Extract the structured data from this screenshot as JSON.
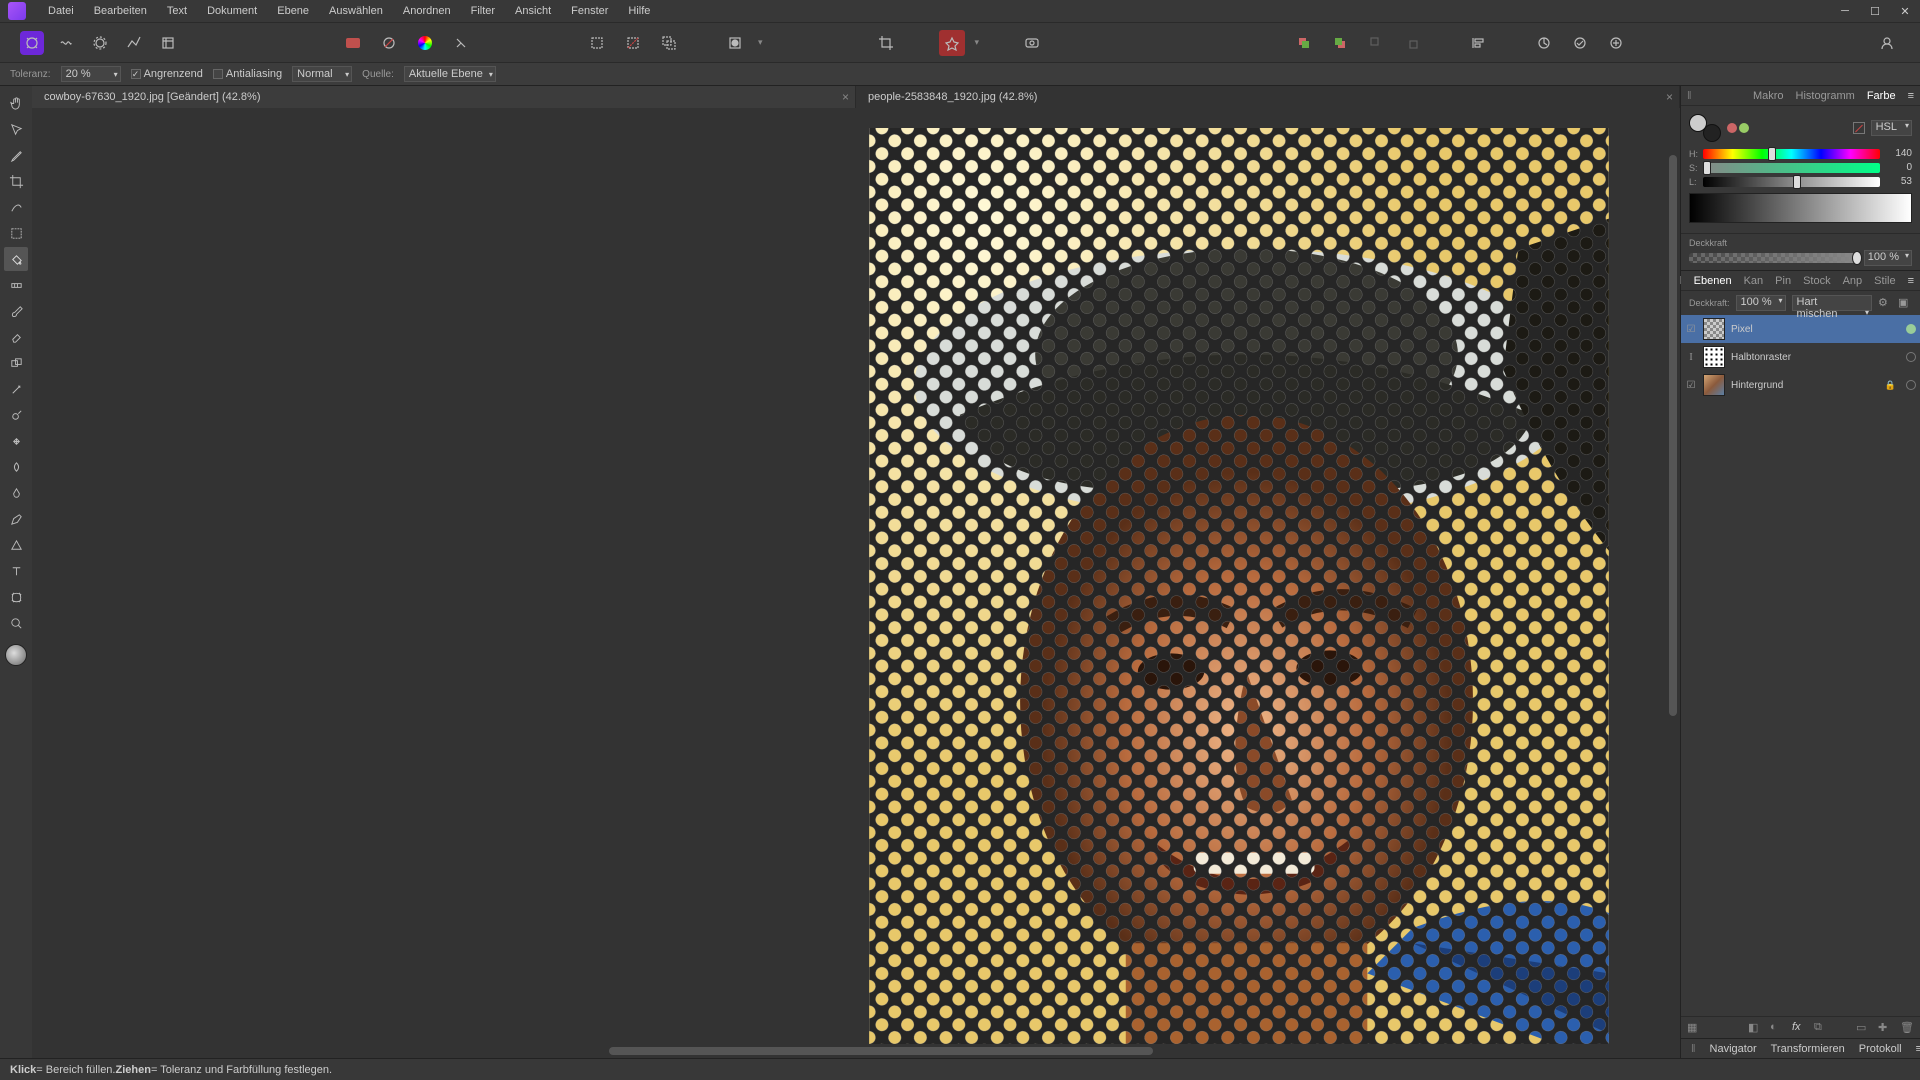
{
  "menu": [
    "Datei",
    "Bearbeiten",
    "Text",
    "Dokument",
    "Ebene",
    "Auswählen",
    "Anordnen",
    "Filter",
    "Ansicht",
    "Fenster",
    "Hilfe"
  ],
  "context": {
    "tolerance_label": "Toleranz:",
    "tolerance_value": "20 %",
    "contiguous": "Angrenzend",
    "antialias": "Antialiasing",
    "blendmode": "Normal",
    "source_label": "Quelle:",
    "source_value": "Aktuelle Ebene"
  },
  "doc_tabs": [
    {
      "title": "cowboy-67630_1920.jpg [Geändert] (42.8%)",
      "active": true
    },
    {
      "title": "people-2583848_1920.jpg (42.8%)",
      "active": false
    }
  ],
  "color_panel": {
    "tabs": [
      "Makro",
      "Histogramm",
      "Farbe"
    ],
    "active_tab": "Farbe",
    "mode": "HSL",
    "h": {
      "label": "H:",
      "value": "140",
      "pos": 39
    },
    "s": {
      "label": "S:",
      "value": "0",
      "pos": 2
    },
    "l": {
      "label": "L:",
      "value": "53",
      "pos": 53
    },
    "opacity_label": "Deckkraft",
    "opacity_value": "100 %"
  },
  "layer_panel": {
    "tabs": [
      "Ebenen",
      "Kan",
      "Pin",
      "Stock",
      "Anp",
      "Stile"
    ],
    "active_tab": "Ebenen",
    "opacity_label": "Deckkraft:",
    "opacity_value": "100 %",
    "blendmode": "Hart mischen",
    "layers": [
      {
        "name": "Pixel",
        "selected": true,
        "thumb": "checker",
        "lock": false
      },
      {
        "name": "Halbtonraster",
        "selected": false,
        "thumb": "halftone",
        "lock": false,
        "editing": true
      },
      {
        "name": "Hintergrund",
        "selected": false,
        "thumb": "photo",
        "lock": true
      }
    ]
  },
  "bottom_tabs": [
    "Navigator",
    "Transformieren",
    "Protokoll"
  ],
  "status": {
    "klick": "Klick",
    "klick_txt": " = Bereich füllen. ",
    "ziehen": "Ziehen",
    "ziehen_txt": " = Toleranz und Farbfüllung festlegen."
  }
}
